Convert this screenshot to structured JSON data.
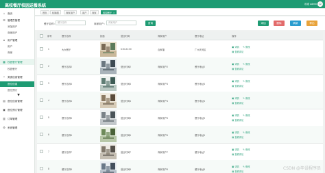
{
  "app": {
    "title": "高校餐厅校园送餐系统",
    "user": "欢迎 admin",
    "avatar_glyph": "☺"
  },
  "sidebar": {
    "groups": [
      {
        "icon": "home-icon",
        "label": "首页"
      },
      {
        "icon": "users-icon",
        "label": "管理员管理"
      },
      {
        "icon": "user-icon",
        "label": "用户管理"
      },
      {
        "icon": "grid-icon",
        "label": "校园餐厅管理"
      },
      {
        "icon": "bowl-icon",
        "label": "美食信息管理"
      },
      {
        "icon": "table-icon",
        "label": "座位信息管理"
      },
      {
        "icon": "ticket-icon",
        "label": "座位预订管理"
      },
      {
        "icon": "order-icon",
        "label": "订单管理"
      },
      {
        "icon": "gear-icon",
        "label": "系统管理"
      }
    ],
    "subs": [
      "添加用户",
      "商家用户",
      "用户",
      "商家",
      "校园餐厅",
      "座位信息",
      "座位预订"
    ]
  },
  "tabs": [
    {
      "label": "首页"
    },
    {
      "label": "轮播图"
    },
    {
      "label": "商家用户"
    },
    {
      "label": "用户"
    },
    {
      "label": "商家"
    },
    {
      "label": "校园餐厅",
      "close": "×"
    }
  ],
  "filter": {
    "label1": "餐厅名称：",
    "placeholder1": "餐厅名称",
    "label2": "商家用户：",
    "placeholder2": "商家用户",
    "query": "查询"
  },
  "toolbar": {
    "add": "添加",
    "delete": "删除",
    "refresh": "刷新",
    "export": "导出"
  },
  "table": {
    "headers": [
      "序号",
      "餐厅名称",
      "封面",
      "营业时间",
      "商家用户",
      "餐厅地址",
      "操作"
    ],
    "rows": [
      {
        "no": "1",
        "name": "大大餐厅",
        "hours": "6:00-21:00",
        "merchant": "合家福",
        "address": "广州天河区"
      },
      {
        "no": "2",
        "name": "餐厅名称2",
        "hours": "营业时间2",
        "merchant": "商家用户2",
        "address": "餐厅地址2"
      },
      {
        "no": "3",
        "name": "餐厅名称3",
        "hours": "营业时间3",
        "merchant": "商家用户3",
        "address": "餐厅地址3"
      },
      {
        "no": "4",
        "name": "餐厅名称4",
        "hours": "营业时间4",
        "merchant": "商家用户4",
        "address": "餐厅地址4"
      },
      {
        "no": "5",
        "name": "餐厅名称5",
        "hours": "营业时间5",
        "merchant": "商家用户5",
        "address": "餐厅地址5"
      },
      {
        "no": "6",
        "name": "餐厅名称6",
        "hours": "营业时间6",
        "merchant": "商家用户6",
        "address": "餐厅地址6"
      },
      {
        "no": "7",
        "name": "餐厅名称7",
        "hours": "营业时间7",
        "merchant": "商家用户7",
        "address": "餐厅地址7"
      },
      {
        "no": "8",
        "name": "餐厅名称8",
        "hours": "营业时间8",
        "merchant": "商家用户8",
        "address": "餐厅地址8"
      }
    ],
    "actions": {
      "detail": "详情",
      "edit": "修改",
      "view_comment": "查看评论"
    }
  },
  "watermark": "CSDN @毕设程序员",
  "colors": {
    "accent": "#1e9b73",
    "delete": "#e26a6a",
    "refresh": "#2a9ccf",
    "export": "#e8a33b"
  }
}
